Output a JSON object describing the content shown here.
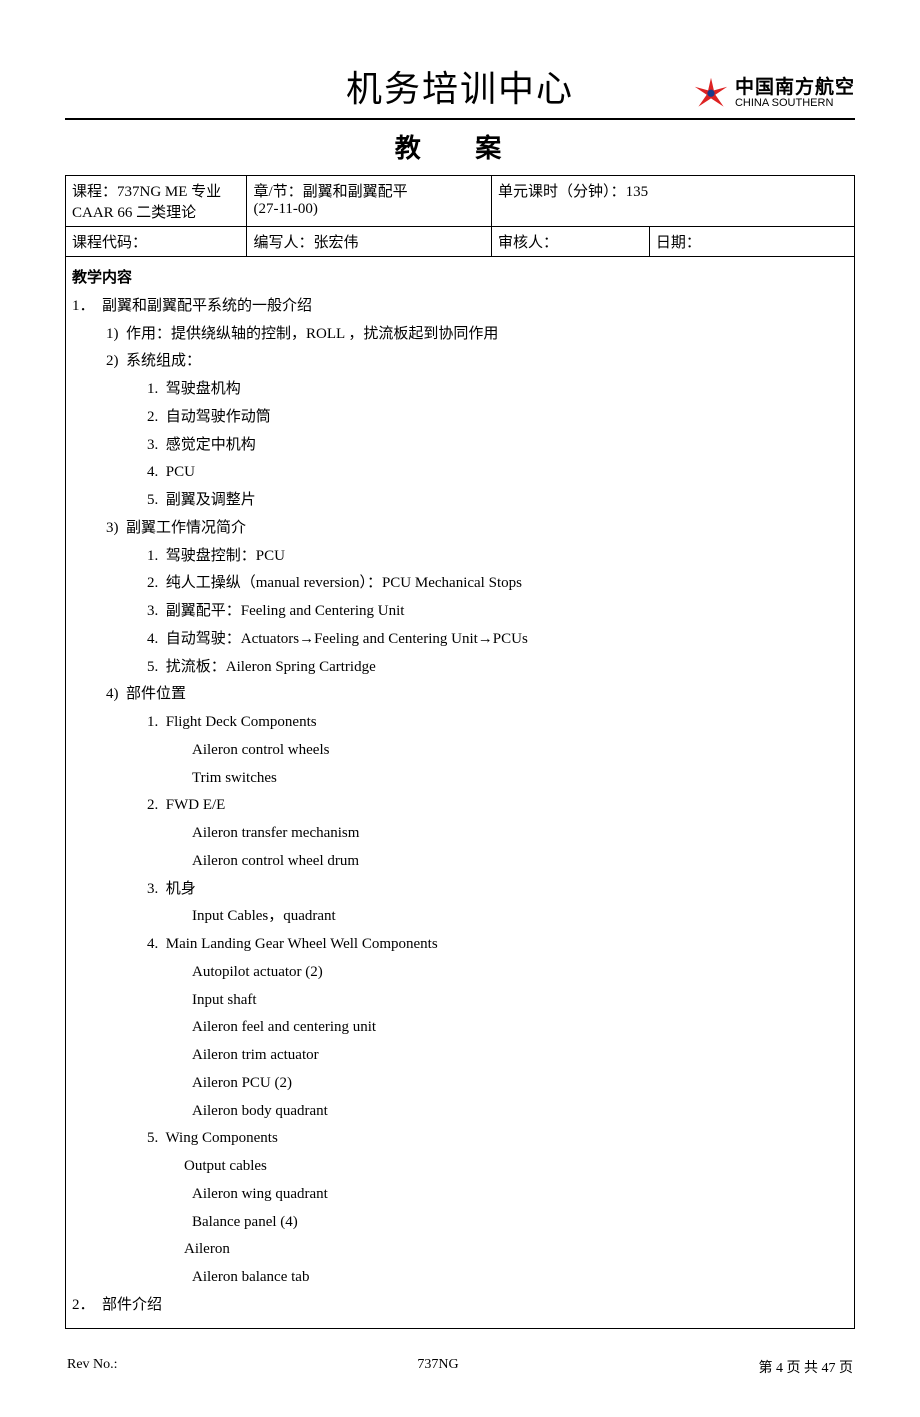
{
  "header": {
    "center_title": "机务培训中心",
    "logo": {
      "cn": "中国南方航空",
      "en": "CHINA SOUTHERN"
    }
  },
  "doc_title": "教  案",
  "meta": {
    "r1c1_label": "课程：",
    "r1c1_value": "737NG ME 专业",
    "r1c1_line2": "CAAR 66 二类理论",
    "r1c2_label": "章/节：",
    "r1c2_value": "副翼和副翼配平",
    "r1c2_line2": "(27-11-00)",
    "r1c3_label": "单元课时（分钟）：",
    "r1c3_value": "135",
    "r2c1_label": "课程代码：",
    "r2c1_value": "",
    "r2c2_label": "编写人：",
    "r2c2_value": "张宏伟",
    "r2c3_label": "审核人：",
    "r2c3_value": "",
    "r2c4_label": "日期：",
    "r2c4_value": ""
  },
  "content": {
    "section_title": "教学内容",
    "lines": [
      {
        "cls": "lvl0",
        "text": "1．  副翼和副翼配平系统的一般介绍"
      },
      {
        "cls": "lvl1",
        "text": "1)  作用：提供绕纵轴的控制，ROLL ，扰流板起到协同作用"
      },
      {
        "cls": "lvl1",
        "text": "2)  系统组成："
      },
      {
        "cls": "lvl2",
        "text": "1.  驾驶盘机构"
      },
      {
        "cls": "lvl2",
        "text": "2.  自动驾驶作动筒"
      },
      {
        "cls": "lvl2",
        "text": "3.  感觉定中机构"
      },
      {
        "cls": "lvl2",
        "text": "4.  PCU"
      },
      {
        "cls": "lvl2",
        "text": "5.  副翼及调整片"
      },
      {
        "cls": "lvl1",
        "text": "3)  副翼工作情况简介"
      },
      {
        "cls": "lvl2",
        "text": "1.  驾驶盘控制：PCU"
      },
      {
        "cls": "lvl2",
        "text": "2.  纯人工操纵（manual reversion）：PCU Mechanical Stops"
      },
      {
        "cls": "lvl2",
        "text": "3.  副翼配平：Feeling and Centering Unit"
      },
      {
        "cls": "lvl2",
        "text": "4.  自动驾驶：Actuators→Feeling and Centering Unit→PCUs"
      },
      {
        "cls": "lvl2",
        "text": "5.  扰流板：Aileron Spring Cartridge"
      },
      {
        "cls": "lvl1",
        "text": "4)  部件位置"
      },
      {
        "cls": "lvl2",
        "text": "1.  Flight Deck Components"
      },
      {
        "cls": "lvl3",
        "text": "Aileron control wheels"
      },
      {
        "cls": "lvl3",
        "text": "Trim switches"
      },
      {
        "cls": "lvl2",
        "text": "2.  FWD E/E"
      },
      {
        "cls": "lvl3",
        "text": "Aileron transfer mechanism"
      },
      {
        "cls": "lvl3",
        "text": "Aileron control wheel drum"
      },
      {
        "cls": "lvl2",
        "text": "3.  机身"
      },
      {
        "cls": "lvl3",
        "text": "Input Cables，quadrant"
      },
      {
        "cls": "lvl2",
        "text": "4.  Main Landing Gear Wheel Well Components"
      },
      {
        "cls": "lvl3",
        "text": "Autopilot actuator (2)"
      },
      {
        "cls": "lvl3",
        "text": "Input shaft"
      },
      {
        "cls": "lvl3",
        "text": "Aileron feel and centering unit"
      },
      {
        "cls": "lvl3",
        "text": "Aileron trim actuator"
      },
      {
        "cls": "lvl3",
        "text": "Aileron PCU (2)"
      },
      {
        "cls": "lvl3",
        "text": "Aileron body quadrant"
      },
      {
        "cls": "lvl2",
        "text": "5.  Wing Components"
      },
      {
        "cls": "lvl3b",
        "text": "Output cables"
      },
      {
        "cls": "lvl3",
        "text": "Aileron wing quadrant"
      },
      {
        "cls": "lvl3",
        "text": "Balance panel (4)"
      },
      {
        "cls": "lvl3b",
        "text": "Aileron"
      },
      {
        "cls": "lvl3",
        "text": "Aileron balance tab"
      },
      {
        "cls": "lvl0",
        "text": "2．  部件介绍"
      }
    ]
  },
  "footer": {
    "left": "Rev No.:",
    "center": "737NG",
    "right": "第 4 页 共 47 页"
  }
}
